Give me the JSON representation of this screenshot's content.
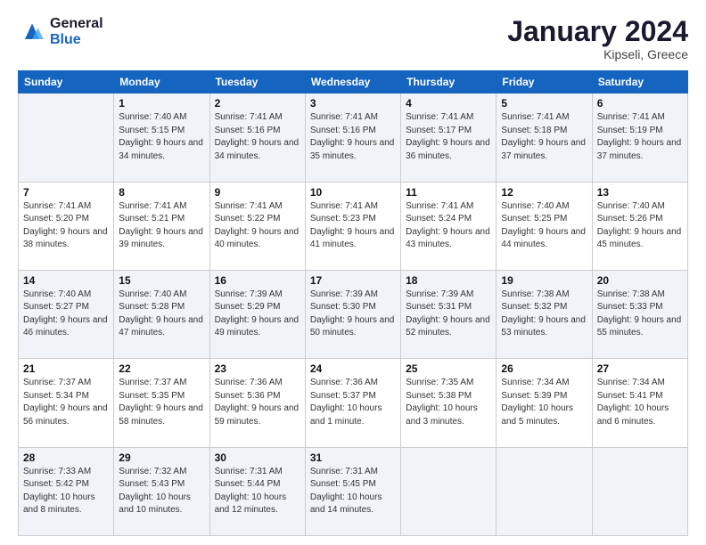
{
  "logo": {
    "line1": "General",
    "line2": "Blue"
  },
  "title": "January 2024",
  "subtitle": "Kipseli, Greece",
  "days": [
    "Sunday",
    "Monday",
    "Tuesday",
    "Wednesday",
    "Thursday",
    "Friday",
    "Saturday"
  ],
  "weeks": [
    [
      {
        "date": "",
        "sunrise": "",
        "sunset": "",
        "daylight": ""
      },
      {
        "date": "1",
        "sunrise": "Sunrise: 7:40 AM",
        "sunset": "Sunset: 5:15 PM",
        "daylight": "Daylight: 9 hours and 34 minutes."
      },
      {
        "date": "2",
        "sunrise": "Sunrise: 7:41 AM",
        "sunset": "Sunset: 5:16 PM",
        "daylight": "Daylight: 9 hours and 34 minutes."
      },
      {
        "date": "3",
        "sunrise": "Sunrise: 7:41 AM",
        "sunset": "Sunset: 5:16 PM",
        "daylight": "Daylight: 9 hours and 35 minutes."
      },
      {
        "date": "4",
        "sunrise": "Sunrise: 7:41 AM",
        "sunset": "Sunset: 5:17 PM",
        "daylight": "Daylight: 9 hours and 36 minutes."
      },
      {
        "date": "5",
        "sunrise": "Sunrise: 7:41 AM",
        "sunset": "Sunset: 5:18 PM",
        "daylight": "Daylight: 9 hours and 37 minutes."
      },
      {
        "date": "6",
        "sunrise": "Sunrise: 7:41 AM",
        "sunset": "Sunset: 5:19 PM",
        "daylight": "Daylight: 9 hours and 37 minutes."
      }
    ],
    [
      {
        "date": "7",
        "sunrise": "Sunrise: 7:41 AM",
        "sunset": "Sunset: 5:20 PM",
        "daylight": "Daylight: 9 hours and 38 minutes."
      },
      {
        "date": "8",
        "sunrise": "Sunrise: 7:41 AM",
        "sunset": "Sunset: 5:21 PM",
        "daylight": "Daylight: 9 hours and 39 minutes."
      },
      {
        "date": "9",
        "sunrise": "Sunrise: 7:41 AM",
        "sunset": "Sunset: 5:22 PM",
        "daylight": "Daylight: 9 hours and 40 minutes."
      },
      {
        "date": "10",
        "sunrise": "Sunrise: 7:41 AM",
        "sunset": "Sunset: 5:23 PM",
        "daylight": "Daylight: 9 hours and 41 minutes."
      },
      {
        "date": "11",
        "sunrise": "Sunrise: 7:41 AM",
        "sunset": "Sunset: 5:24 PM",
        "daylight": "Daylight: 9 hours and 43 minutes."
      },
      {
        "date": "12",
        "sunrise": "Sunrise: 7:40 AM",
        "sunset": "Sunset: 5:25 PM",
        "daylight": "Daylight: 9 hours and 44 minutes."
      },
      {
        "date": "13",
        "sunrise": "Sunrise: 7:40 AM",
        "sunset": "Sunset: 5:26 PM",
        "daylight": "Daylight: 9 hours and 45 minutes."
      }
    ],
    [
      {
        "date": "14",
        "sunrise": "Sunrise: 7:40 AM",
        "sunset": "Sunset: 5:27 PM",
        "daylight": "Daylight: 9 hours and 46 minutes."
      },
      {
        "date": "15",
        "sunrise": "Sunrise: 7:40 AM",
        "sunset": "Sunset: 5:28 PM",
        "daylight": "Daylight: 9 hours and 47 minutes."
      },
      {
        "date": "16",
        "sunrise": "Sunrise: 7:39 AM",
        "sunset": "Sunset: 5:29 PM",
        "daylight": "Daylight: 9 hours and 49 minutes."
      },
      {
        "date": "17",
        "sunrise": "Sunrise: 7:39 AM",
        "sunset": "Sunset: 5:30 PM",
        "daylight": "Daylight: 9 hours and 50 minutes."
      },
      {
        "date": "18",
        "sunrise": "Sunrise: 7:39 AM",
        "sunset": "Sunset: 5:31 PM",
        "daylight": "Daylight: 9 hours and 52 minutes."
      },
      {
        "date": "19",
        "sunrise": "Sunrise: 7:38 AM",
        "sunset": "Sunset: 5:32 PM",
        "daylight": "Daylight: 9 hours and 53 minutes."
      },
      {
        "date": "20",
        "sunrise": "Sunrise: 7:38 AM",
        "sunset": "Sunset: 5:33 PM",
        "daylight": "Daylight: 9 hours and 55 minutes."
      }
    ],
    [
      {
        "date": "21",
        "sunrise": "Sunrise: 7:37 AM",
        "sunset": "Sunset: 5:34 PM",
        "daylight": "Daylight: 9 hours and 56 minutes."
      },
      {
        "date": "22",
        "sunrise": "Sunrise: 7:37 AM",
        "sunset": "Sunset: 5:35 PM",
        "daylight": "Daylight: 9 hours and 58 minutes."
      },
      {
        "date": "23",
        "sunrise": "Sunrise: 7:36 AM",
        "sunset": "Sunset: 5:36 PM",
        "daylight": "Daylight: 9 hours and 59 minutes."
      },
      {
        "date": "24",
        "sunrise": "Sunrise: 7:36 AM",
        "sunset": "Sunset: 5:37 PM",
        "daylight": "Daylight: 10 hours and 1 minute."
      },
      {
        "date": "25",
        "sunrise": "Sunrise: 7:35 AM",
        "sunset": "Sunset: 5:38 PM",
        "daylight": "Daylight: 10 hours and 3 minutes."
      },
      {
        "date": "26",
        "sunrise": "Sunrise: 7:34 AM",
        "sunset": "Sunset: 5:39 PM",
        "daylight": "Daylight: 10 hours and 5 minutes."
      },
      {
        "date": "27",
        "sunrise": "Sunrise: 7:34 AM",
        "sunset": "Sunset: 5:41 PM",
        "daylight": "Daylight: 10 hours and 6 minutes."
      }
    ],
    [
      {
        "date": "28",
        "sunrise": "Sunrise: 7:33 AM",
        "sunset": "Sunset: 5:42 PM",
        "daylight": "Daylight: 10 hours and 8 minutes."
      },
      {
        "date": "29",
        "sunrise": "Sunrise: 7:32 AM",
        "sunset": "Sunset: 5:43 PM",
        "daylight": "Daylight: 10 hours and 10 minutes."
      },
      {
        "date": "30",
        "sunrise": "Sunrise: 7:31 AM",
        "sunset": "Sunset: 5:44 PM",
        "daylight": "Daylight: 10 hours and 12 minutes."
      },
      {
        "date": "31",
        "sunrise": "Sunrise: 7:31 AM",
        "sunset": "Sunset: 5:45 PM",
        "daylight": "Daylight: 10 hours and 14 minutes."
      },
      {
        "date": "",
        "sunrise": "",
        "sunset": "",
        "daylight": ""
      },
      {
        "date": "",
        "sunrise": "",
        "sunset": "",
        "daylight": ""
      },
      {
        "date": "",
        "sunrise": "",
        "sunset": "",
        "daylight": ""
      }
    ]
  ]
}
